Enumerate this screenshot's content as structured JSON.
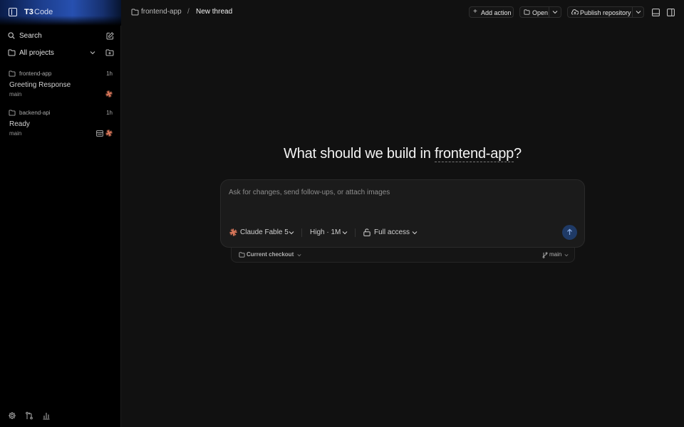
{
  "app": {
    "name": "T3",
    "name_suffix": "Code"
  },
  "sidebar": {
    "search_label": "Search",
    "projects_label": "All projects",
    "threads": [
      {
        "project": "frontend-app",
        "age": "1h",
        "title": "Greeting Response",
        "branch": "main"
      },
      {
        "project": "backend-api",
        "age": "1h",
        "title": "Ready",
        "branch": "main"
      }
    ]
  },
  "breadcrumb": {
    "project": "frontend-app",
    "separator": "/",
    "thread": "New thread"
  },
  "toolbar": {
    "add_action_label": "Add action",
    "open_label": "Open",
    "publish_label": "Publish repository"
  },
  "main": {
    "headline_prefix": "What should we build in ",
    "headline_project": "frontend-app",
    "headline_suffix": "?",
    "composer": {
      "placeholder": "Ask for changes, send follow-ups, or attach images",
      "model_label": "Claude Fable 5",
      "effort_label": "High · 1M",
      "access_label": "Full access"
    },
    "checkout": {
      "label": "Current checkout",
      "branch": "main"
    }
  },
  "colors": {
    "accent": "#2750b0",
    "send_button": "#1f3a66",
    "spark": "#d9775a"
  }
}
